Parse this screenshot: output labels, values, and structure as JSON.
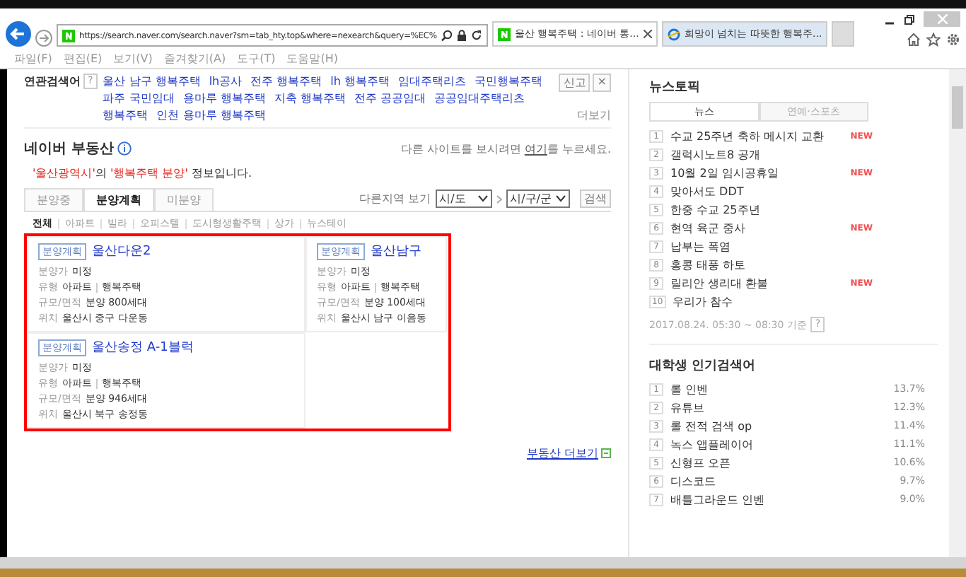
{
  "browser": {
    "url": "https://search.naver.com/search.naver?sm=tab_hty.top&where=nexearch&query=%EC%",
    "tabs": [
      {
        "title": "울산 행복주택 : 네이버 통...",
        "selected": true,
        "kind": "naver"
      },
      {
        "title": "희망이 넘치는 따뜻한 행복주...",
        "selected": false,
        "kind": "ie"
      }
    ],
    "menu": [
      "파일(F)",
      "편집(E)",
      "보기(V)",
      "즐겨찾기(A)",
      "도구(T)",
      "도움말(H)"
    ]
  },
  "related": {
    "label": "연관검색어",
    "help": "?",
    "keywords": [
      "울산 남구 행복주택",
      "lh공사",
      "전주 행복주택",
      "lh 행복주택",
      "임대주택리츠",
      "국민행복주택",
      "파주 국민임대",
      "용마루 행복주택",
      "지축 행복주택",
      "전주 공공임대",
      "공공임대주택리츠",
      "행복주택",
      "인천 용마루 행복주택"
    ],
    "report": "신고",
    "close": "×",
    "more": "더보기"
  },
  "realestate": {
    "title": "네이버 부동산",
    "other_site": [
      {
        "text": "다른 사이트를 보시려면 ",
        "link": false
      },
      {
        "text": "여기",
        "link": true
      },
      {
        "text": "를 누르세요.",
        "link": false
      }
    ],
    "notice": [
      {
        "text": "'울산광역시'",
        "highlight": true
      },
      {
        "text": "의 ",
        "highlight": false
      },
      {
        "text": "'행복주택 분양'",
        "highlight": true
      },
      {
        "text": " 정보입니다.",
        "highlight": false
      }
    ],
    "tabs": [
      {
        "label": "분양중",
        "selected": false
      },
      {
        "label": "분양계획",
        "selected": true
      },
      {
        "label": "미분양",
        "selected": false
      }
    ],
    "region": {
      "label": "다른지역 보기",
      "selects": [
        "시/도",
        "시/구/군"
      ],
      "button": "검색"
    },
    "categories": [
      {
        "label": "전체",
        "selected": true
      },
      {
        "label": "아파트",
        "selected": false
      },
      {
        "label": "빌라",
        "selected": false
      },
      {
        "label": "오피스텔",
        "selected": false
      },
      {
        "label": "도시형생활주택",
        "selected": false
      },
      {
        "label": "상가",
        "selected": false
      },
      {
        "label": "뉴스테이",
        "selected": false
      }
    ],
    "cards": [
      {
        "badge": "분양계획",
        "title": "울산다운2",
        "fields": [
          {
            "label": "분양가",
            "values": [
              "미정"
            ]
          },
          {
            "label": "유형",
            "values": [
              "아파트",
              "행복주택"
            ]
          },
          {
            "label": "규모/면적",
            "values": [
              "분양 800세대"
            ]
          },
          {
            "label": "위치",
            "values": [
              "울산시 중구 다운동"
            ]
          }
        ]
      },
      {
        "badge": "분양계획",
        "title": "울산남구",
        "fields": [
          {
            "label": "분양가",
            "values": [
              "미정"
            ]
          },
          {
            "label": "유형",
            "values": [
              "아파트",
              "행복주택"
            ]
          },
          {
            "label": "규모/면적",
            "values": [
              "분양 100세대"
            ]
          },
          {
            "label": "위치",
            "values": [
              "울산시 남구 이음동"
            ]
          }
        ]
      },
      {
        "badge": "분양계획",
        "title": "울산송정 A-1블럭",
        "fields": [
          {
            "label": "분양가",
            "values": [
              "미정"
            ]
          },
          {
            "label": "유형",
            "values": [
              "아파트",
              "행복주택"
            ]
          },
          {
            "label": "규모/면적",
            "values": [
              "분양 946세대"
            ]
          },
          {
            "label": "위치",
            "values": [
              "울산시 북구 송정동"
            ]
          }
        ]
      }
    ],
    "more_link": "부동산 더보기"
  },
  "news_topic": {
    "title": "뉴스토픽",
    "tabs": [
      {
        "label": "뉴스",
        "selected": true
      },
      {
        "label": "연예·스포츠",
        "selected": false
      }
    ],
    "items": [
      {
        "rank": "1",
        "text": "수교 25주년 축하 메시지 교환",
        "badge": "NEW"
      },
      {
        "rank": "2",
        "text": "갤럭시노트8 공개"
      },
      {
        "rank": "3",
        "text": "10월 2일 임시공휴일",
        "badge": "NEW"
      },
      {
        "rank": "4",
        "text": "맞아서도 DDT"
      },
      {
        "rank": "5",
        "text": "한중 수교 25주년"
      },
      {
        "rank": "6",
        "text": "현역 육군 중사",
        "badge": "NEW"
      },
      {
        "rank": "7",
        "text": "납부는 폭염"
      },
      {
        "rank": "8",
        "text": "홍콩 태풍 하토"
      },
      {
        "rank": "9",
        "text": "릴리안 생리대 환불",
        "badge": "NEW"
      },
      {
        "rank": "10",
        "text": "우리가 참수"
      }
    ],
    "timestamp": "2017.08.24. 05:30 ~ 08:30 기준",
    "help": "?"
  },
  "popular": {
    "title": "대학생 인기검색어",
    "items": [
      {
        "rank": "1",
        "text": "롤 인벤",
        "share": "13.7%"
      },
      {
        "rank": "2",
        "text": "유튜브",
        "share": "12.3%"
      },
      {
        "rank": "3",
        "text": "롤 전적 검색 op",
        "share": "11.4%"
      },
      {
        "rank": "4",
        "text": "녹스 앱플레이어",
        "share": "11.1%"
      },
      {
        "rank": "5",
        "text": "신형프 오픈",
        "share": "10.6%"
      },
      {
        "rank": "6",
        "text": "디스코드",
        "share": "9.7%"
      },
      {
        "rank": "7",
        "text": "배틀그라운드 인벤",
        "share": "9.0%"
      }
    ]
  }
}
